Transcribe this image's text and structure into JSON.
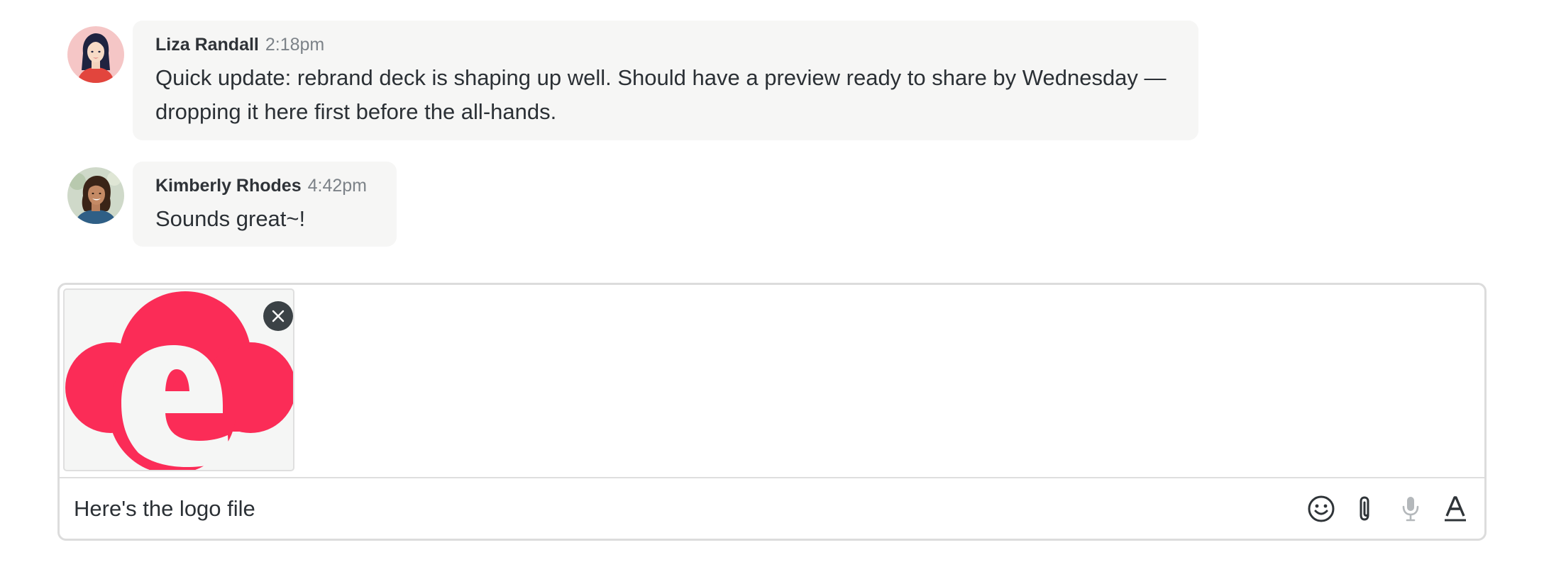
{
  "messages": [
    {
      "author": "Liza Randall",
      "time": "2:18pm",
      "text": "Quick update: rebrand deck is shaping up well. Should have a preview ready to share by Wednesday — dropping it here first before the all-hands.",
      "avatar": "illustrated-woman-avatar"
    },
    {
      "author": "Kimberly Rhodes",
      "time": "4:42pm",
      "text": "Sounds great~!",
      "avatar": "photo-woman-avatar"
    }
  ],
  "composer": {
    "attachment": {
      "type": "image",
      "icon": "cloud-e-logo",
      "remove_icon": "close-icon"
    },
    "input_value": "Here's the logo file",
    "toolbar": [
      {
        "name": "emoji",
        "icon": "smiley-icon"
      },
      {
        "name": "attach",
        "icon": "paperclip-icon"
      },
      {
        "name": "voice",
        "icon": "microphone-icon"
      },
      {
        "name": "format",
        "icon": "text-format-icon"
      }
    ]
  },
  "colors": {
    "bubble_bg": "#f6f6f5",
    "logo_red": "#fb2c57",
    "text": "#2b3035",
    "muted": "#7c8288",
    "border": "#dcdcdc"
  }
}
